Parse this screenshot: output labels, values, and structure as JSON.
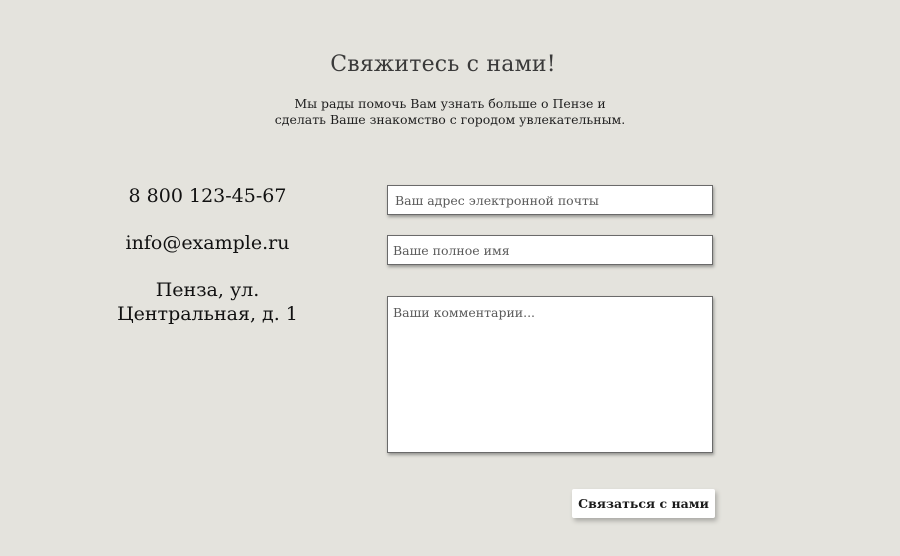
{
  "header": {
    "title": "Свяжитесь с нами!",
    "subtitle_line1": "Мы рады помочь Вам узнать больше о Пензе и",
    "subtitle_line2": "сделать Ваше знакомство с городом увлекательным."
  },
  "contacts": {
    "phone": "8 800 123-45-67",
    "email": "info@example.ru",
    "address_line1": "Пенза, ул.",
    "address_line2": "Центральная, д. 1"
  },
  "form": {
    "email_placeholder": "Ваш адрес электронной почты",
    "name_placeholder": "Ваше полное имя",
    "comment_placeholder": "Ваши комментарии...",
    "submit_label": "Связаться с нами"
  },
  "colors": {
    "background": "#e4e3dd",
    "field_background": "#ffffff",
    "field_border": "#6a6a6a"
  }
}
